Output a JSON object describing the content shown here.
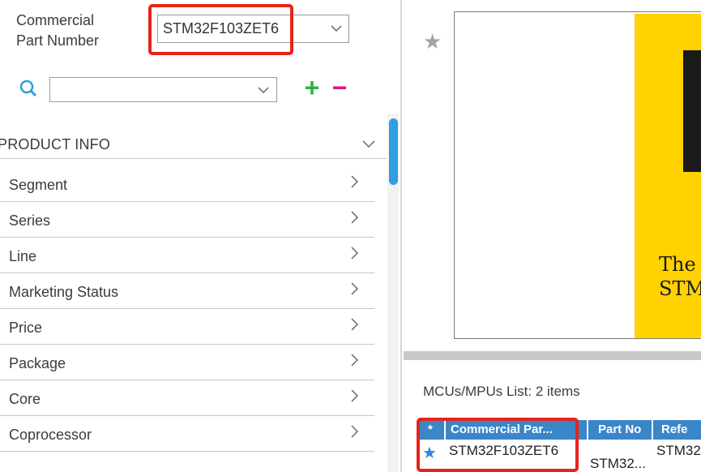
{
  "filters": {
    "commercial_part_number_label": "Commercial\nPart Number",
    "commercial_part_number_value": "STM32F103ZET6",
    "search_value": "",
    "add_symbol": "+",
    "remove_symbol": "−"
  },
  "product_info": {
    "title": "PRODUCT INFO",
    "items": [
      {
        "label": "Segment"
      },
      {
        "label": "Series"
      },
      {
        "label": "Line"
      },
      {
        "label": "Marketing Status"
      },
      {
        "label": "Price"
      },
      {
        "label": "Package"
      },
      {
        "label": "Core"
      },
      {
        "label": "Coprocessor"
      }
    ]
  },
  "preview": {
    "banner_line1": "The",
    "banner_line2": "STM"
  },
  "mcu_list": {
    "caption": "MCUs/MPUs List: 2 items",
    "columns": [
      "*",
      "Commercial Par...",
      "Part No",
      "Refe"
    ],
    "rows": [
      {
        "commercial": "STM32F103ZET6",
        "part_no": "STM32...",
        "reference": "STM32"
      }
    ]
  },
  "colors": {
    "accent": "#2e9fe0",
    "add": "#2fb046",
    "remove": "#e3147d",
    "highlight": "#e8231a",
    "table_header": "#3a86c8",
    "banner": "#ffd200"
  },
  "icons": [
    "search-icon",
    "chevron-down-icon",
    "chevron-right-icon",
    "star-icon"
  ]
}
